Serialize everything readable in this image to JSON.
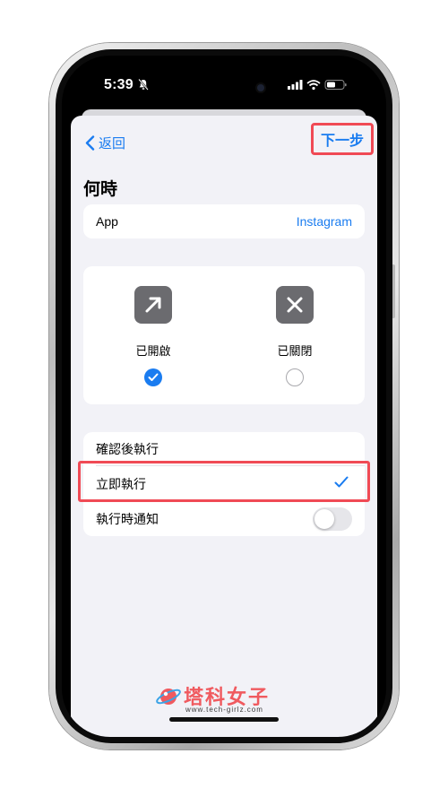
{
  "status_bar": {
    "time": "5:39"
  },
  "nav": {
    "back_label": "返回",
    "next_label": "下一步"
  },
  "section_title": "何時",
  "app_row": {
    "label": "App",
    "value": "Instagram"
  },
  "states": [
    {
      "label": "已開啟",
      "selected": true,
      "icon": "arrow-up-right-icon"
    },
    {
      "label": "已關閉",
      "selected": false,
      "icon": "close-x-icon"
    }
  ],
  "options": [
    {
      "label": "確認後執行"
    },
    {
      "label": "立即執行",
      "checked": true
    },
    {
      "label": "執行時通知",
      "toggle": false
    }
  ],
  "watermark": {
    "name": "塔科女子",
    "url": "www.tech-girlz.com"
  },
  "colors": {
    "accent": "#1a7cf0",
    "highlight": "#f04a55",
    "background": "#f2f2f7"
  }
}
